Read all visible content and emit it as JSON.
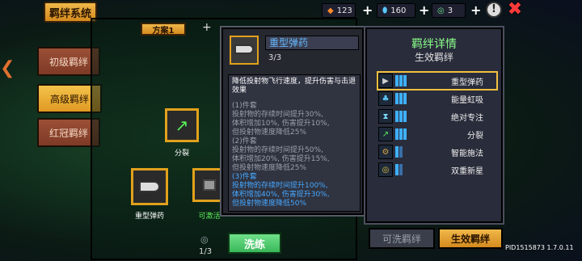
{
  "title": "羁绊系统",
  "plan_tab": "方案1",
  "add_tab": "+",
  "resources": [
    {
      "icon": "fire-gem-icon",
      "value": "123"
    },
    {
      "icon": "blue-gem-icon",
      "value": "160"
    },
    {
      "icon": "green-ring-icon",
      "value": "3"
    }
  ],
  "left_tabs": [
    {
      "label": "初级羁绊",
      "active": false
    },
    {
      "label": "高级羁绊",
      "active": true
    },
    {
      "label": "红冠羁绊",
      "active": false
    }
  ],
  "board": {
    "nodes": [
      {
        "name": "split",
        "label": "分裂"
      },
      {
        "name": "heavy-ammo",
        "label": "重型弹药"
      },
      {
        "name": "locked",
        "label": "可激活"
      }
    ],
    "counter": "1/3",
    "wash_button": "洗练"
  },
  "tooltip": {
    "title": "重型弹药",
    "count": "3/3",
    "description": "降低投射物飞行速度，提升伤害与击退效果",
    "levels": [
      {
        "head": "(1)件套",
        "lines": [
          "投射物的存续时间提升30%,",
          "体积增加10%, 伤害提升10%,",
          "但投射物速度降低25%"
        ],
        "active": false
      },
      {
        "head": "(2)件套",
        "lines": [
          "投射物的存续时间提升50%,",
          "体积增加20%, 伤害提升15%,",
          "但投射物速度降低25%"
        ],
        "active": false
      },
      {
        "head": "(3)件套",
        "lines": [
          "投射物的存续时间提升100%,",
          "体积增加40%, 伤害提升30%,",
          "但投射物速度降低50%"
        ],
        "active": true
      }
    ]
  },
  "detail_panel": {
    "title": "羁绊详情",
    "subtitle": "生效羁绊",
    "bonds": [
      {
        "name": "重型弹药",
        "icon": "bullet-icon",
        "filled": 3,
        "total": 3
      },
      {
        "name": "能量虹吸",
        "icon": "siphon-icon",
        "filled": 3,
        "total": 3
      },
      {
        "name": "绝对专注",
        "icon": "hourglass-icon",
        "filled": 3,
        "total": 3
      },
      {
        "name": "分裂",
        "icon": "split-arrows-icon",
        "filled": 3,
        "total": 3
      },
      {
        "name": "智能施法",
        "icon": "gear-icon",
        "filled": 1,
        "total": 2
      },
      {
        "name": "双重新星",
        "icon": "nova-icon",
        "filled": 1,
        "total": 2
      }
    ]
  },
  "bottom_tabs": [
    {
      "label": "可洗羁绊",
      "active": false
    },
    {
      "label": "生效羁绊",
      "active": true
    }
  ],
  "version": "PID1515873 1.7.0.11",
  "colors": {
    "gold": "#e1a11c",
    "blue_text": "#46a8ff",
    "green_title": "#8cff8c"
  }
}
